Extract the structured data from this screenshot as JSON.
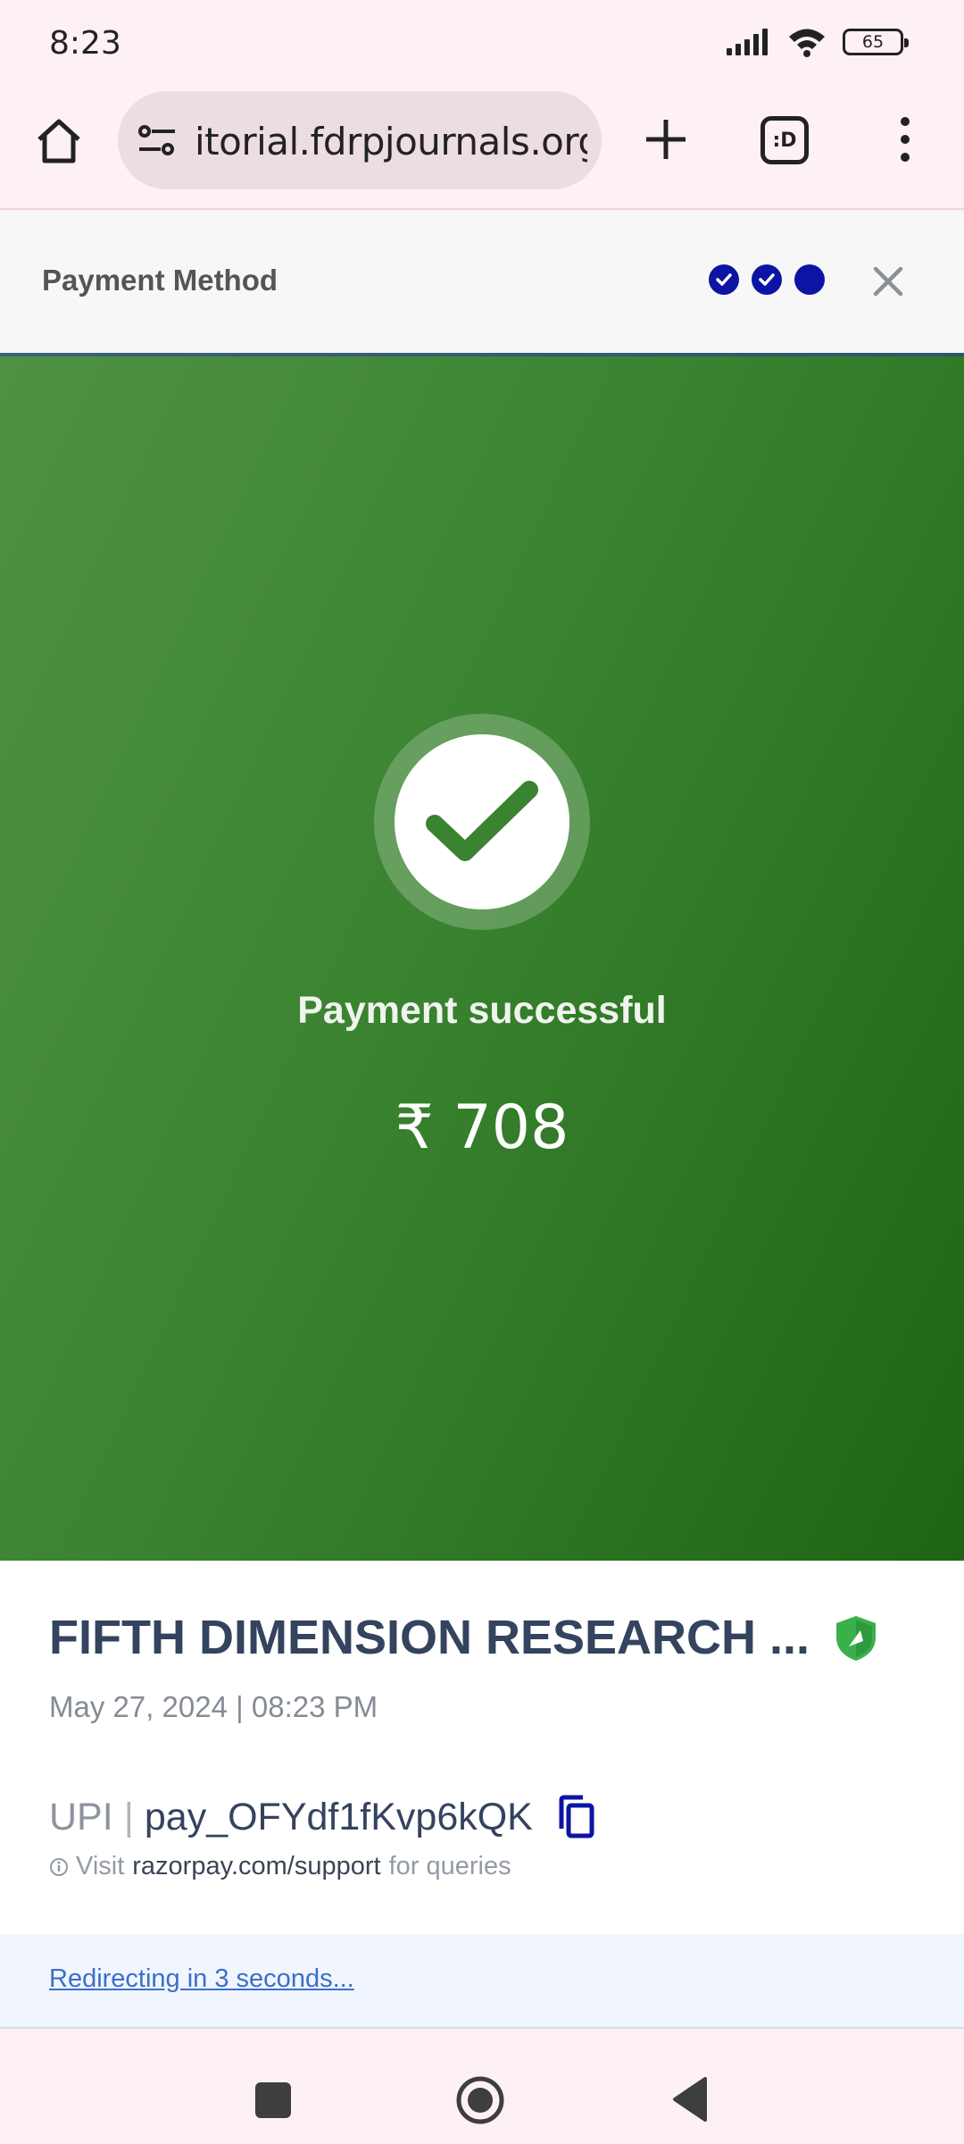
{
  "status_bar": {
    "time": "8:23",
    "battery": "65",
    "icons": [
      "signal-icon",
      "wifi-icon",
      "battery-icon"
    ]
  },
  "browser": {
    "url": "itorial.fdrpjournals.org",
    "tabs_label": ":D",
    "icons": [
      "home-icon",
      "site-settings-icon",
      "new-tab-icon",
      "tabs-icon",
      "menu-icon"
    ]
  },
  "checkout": {
    "title": "Payment Method",
    "steps": [
      "done",
      "done",
      "current"
    ],
    "accent_color": "#0d14a3"
  },
  "success": {
    "message": "Payment successful",
    "amount": "₹ 708",
    "colors": {
      "start": "#4f9342",
      "end": "#1d6512"
    }
  },
  "details": {
    "merchant": "FIFTH DIMENSION RESEARCH ...",
    "date": "May 27, 2024",
    "time": "08:23 PM",
    "separator": "|",
    "method": "UPI",
    "payment_id": "pay_OFYdf1fKvp6kQK",
    "support_prefix": "Visit",
    "support_link": "razorpay.com/support",
    "support_suffix": "for queries"
  },
  "redirect": {
    "text": "Redirecting in 3 seconds..."
  },
  "nav": {
    "icons": [
      "recents-icon",
      "home-icon",
      "back-icon"
    ]
  }
}
